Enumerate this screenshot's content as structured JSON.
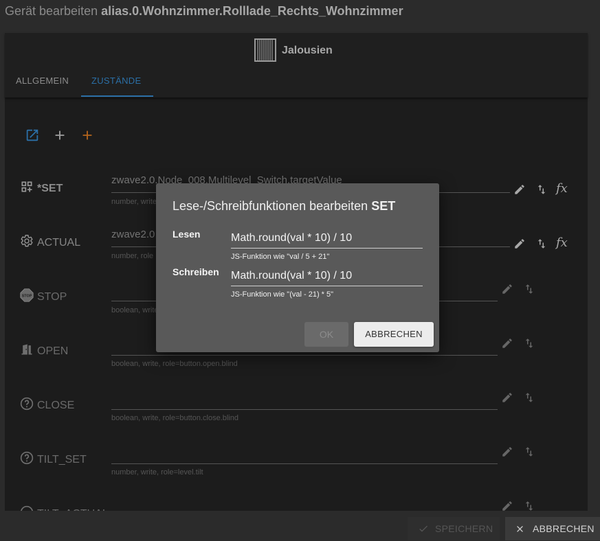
{
  "window": {
    "title_prefix": "Gerät bearbeiten",
    "title_object": "alias.0.Wohnzimmer.Rolllade_Rechts_Wohnzimmer"
  },
  "device": {
    "type_label": "Jalousien",
    "type_icon": "blinds-icon"
  },
  "tabs": [
    {
      "label": "ALLGEMEIN"
    },
    {
      "label": "ZUSTÄNDE"
    }
  ],
  "toolbar": {
    "icons": [
      "open-in-new-icon",
      "add-icon",
      "add-orange-icon"
    ]
  },
  "states": [
    {
      "name": "*SET",
      "icon": "view-grid-plus-icon",
      "value": "zwave2.0.Node_008.Multilevel_Switch.targetValue",
      "help": "number, write",
      "actions": [
        "edit-icon",
        "swap-vertical-icon",
        "function-icon"
      ]
    },
    {
      "name": "ACTUAL",
      "icon": "gear-icon",
      "value": "zwave2.0",
      "help": "number, role",
      "actions": [
        "edit-icon",
        "swap-vertical-icon",
        "function-icon"
      ]
    },
    {
      "name": "STOP",
      "icon": "stop-sign-icon",
      "value": "",
      "help": "boolean, write",
      "actions": [
        "edit-icon",
        "swap-vertical-icon"
      ]
    },
    {
      "name": "OPEN",
      "icon": "door-open-icon",
      "value": "",
      "help": "boolean, write, role=button.open.blind",
      "actions": [
        "edit-icon",
        "swap-vertical-icon"
      ]
    },
    {
      "name": "CLOSE",
      "icon": "help-circle-icon",
      "value": "",
      "help": "boolean, write, role=button.close.blind",
      "actions": [
        "edit-icon",
        "swap-vertical-icon"
      ]
    },
    {
      "name": "TILT_SET",
      "icon": "help-circle-icon",
      "value": "",
      "help": "number, write, role=level.tilt",
      "actions": [
        "edit-icon",
        "swap-vertical-icon"
      ]
    },
    {
      "name": "TILT_ACTUAL",
      "icon": "help-circle-icon",
      "value": "",
      "help": "",
      "actions": [
        "edit-icon",
        "swap-vertical-icon"
      ]
    }
  ],
  "footer": {
    "save_label": "SPEICHERN",
    "cancel_label": "ABBRECHEN"
  },
  "dialog": {
    "title_prefix": "Lese-/Schreibfunktionen bearbeiten",
    "title_state": "SET",
    "read_label": "Lesen",
    "read_value": "Math.round(val * 10) / 10",
    "read_help": "JS-Funktion wie \"val / 5 + 21\"",
    "write_label": "Schreiben",
    "write_value": "Math.round(val * 10) / 10",
    "write_help": "JS-Funktion wie \"(val - 21) * 5\"",
    "ok_label": "OK",
    "cancel_label": "ABBRECHEN"
  },
  "colors": {
    "accent": "#2b6fa6",
    "orange": "#b5651d",
    "dialog_bg": "#595959"
  }
}
